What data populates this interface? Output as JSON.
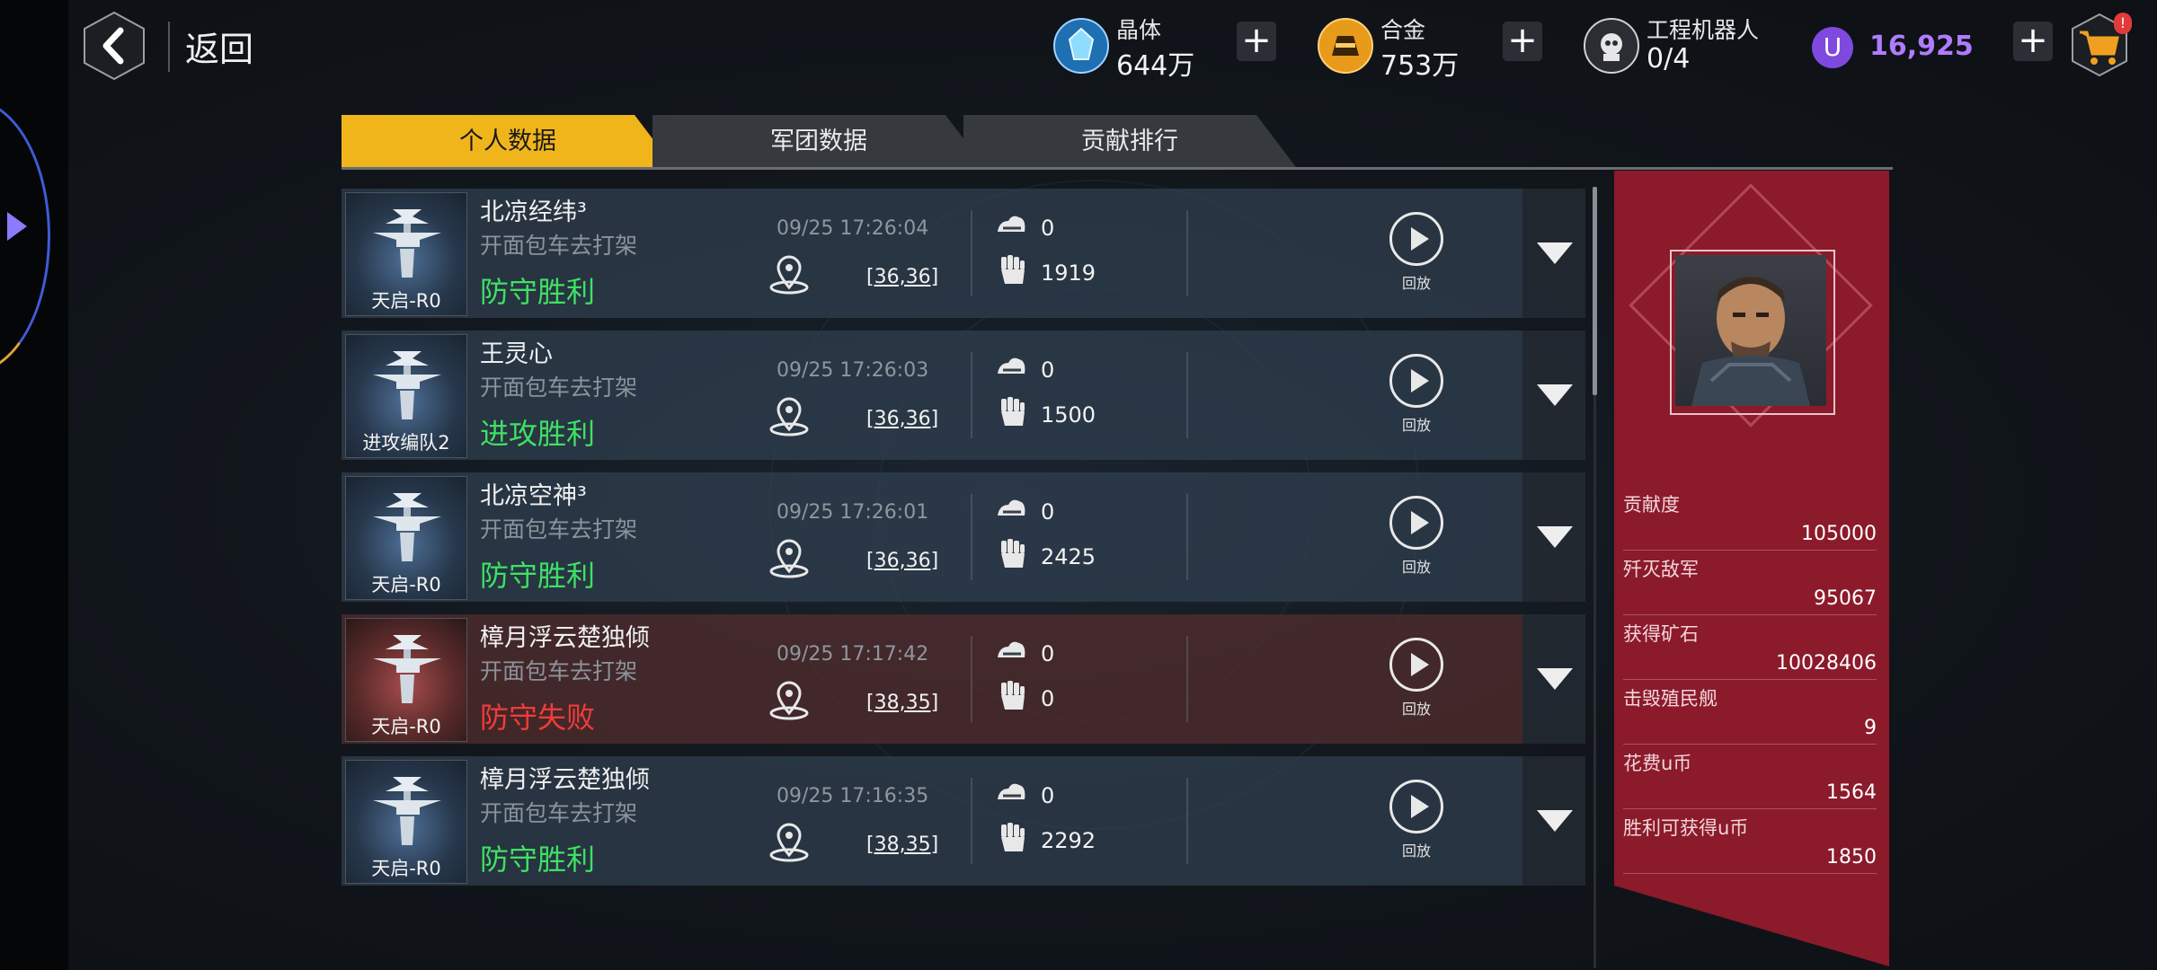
{
  "header": {
    "back_label": "返回",
    "resources": [
      {
        "name": "晶体",
        "value": "644万",
        "icon": "crystal-icon"
      },
      {
        "name": "合金",
        "value": "753万",
        "icon": "alloy-icon"
      },
      {
        "name": "工程机器人",
        "value": "0/4",
        "icon": "robot-icon"
      }
    ],
    "ucoin": {
      "value": "16,925",
      "icon": "u-coin-icon"
    },
    "shop": {
      "icon": "shopping-cart-icon",
      "badge_icon": "notification-badge-icon"
    }
  },
  "tabs": [
    {
      "label": "个人数据",
      "active": true
    },
    {
      "label": "军团数据",
      "active": false
    },
    {
      "label": "贡献排行",
      "active": false
    }
  ],
  "records": [
    {
      "thumb_label": "天启-R0",
      "name": "北凉经纬³",
      "sub": "开面包车去打架",
      "result": "防守胜利",
      "win": true,
      "time": "09/25 17:26:04",
      "coord": "[36,36]",
      "stat_a": "0",
      "stat_b": "1919",
      "replay": "回放"
    },
    {
      "thumb_label": "进攻编队2",
      "name": "王灵心",
      "sub": "开面包车去打架",
      "result": "进攻胜利",
      "win": true,
      "time": "09/25 17:26:03",
      "coord": "[36,36]",
      "stat_a": "0",
      "stat_b": "1500",
      "replay": "回放"
    },
    {
      "thumb_label": "天启-R0",
      "name": "北凉空神³",
      "sub": "开面包车去打架",
      "result": "防守胜利",
      "win": true,
      "time": "09/25 17:26:01",
      "coord": "[36,36]",
      "stat_a": "0",
      "stat_b": "2425",
      "replay": "回放"
    },
    {
      "thumb_label": "天启-R0",
      "name": "樟月浮云楚独倾",
      "sub": "开面包车去打架",
      "result": "防守失败",
      "win": false,
      "time": "09/25 17:17:42",
      "coord": "[38,35]",
      "stat_a": "0",
      "stat_b": "0",
      "replay": "回放"
    },
    {
      "thumb_label": "天启-R0",
      "name": "樟月浮云楚独倾",
      "sub": "开面包车去打架",
      "result": "防守胜利",
      "win": true,
      "time": "09/25 17:16:35",
      "coord": "[38,35]",
      "stat_a": "0",
      "stat_b": "2292",
      "replay": "回放"
    }
  ],
  "summary": [
    {
      "label": "贡献度",
      "value": "105000"
    },
    {
      "label": "歼灭敌军",
      "value": "95067"
    },
    {
      "label": "获得矿石",
      "value": "10028406"
    },
    {
      "label": "击毁殖民舰",
      "value": "9"
    },
    {
      "label": "花费u币",
      "value": "1564"
    },
    {
      "label": "胜利可获得u币",
      "value": "1850"
    }
  ],
  "colors": {
    "accent": "#f1b51c",
    "win": "#3fe064",
    "lose": "#f23b3b",
    "panel": "#8b1a2b",
    "ucoin": "#b07cff"
  }
}
